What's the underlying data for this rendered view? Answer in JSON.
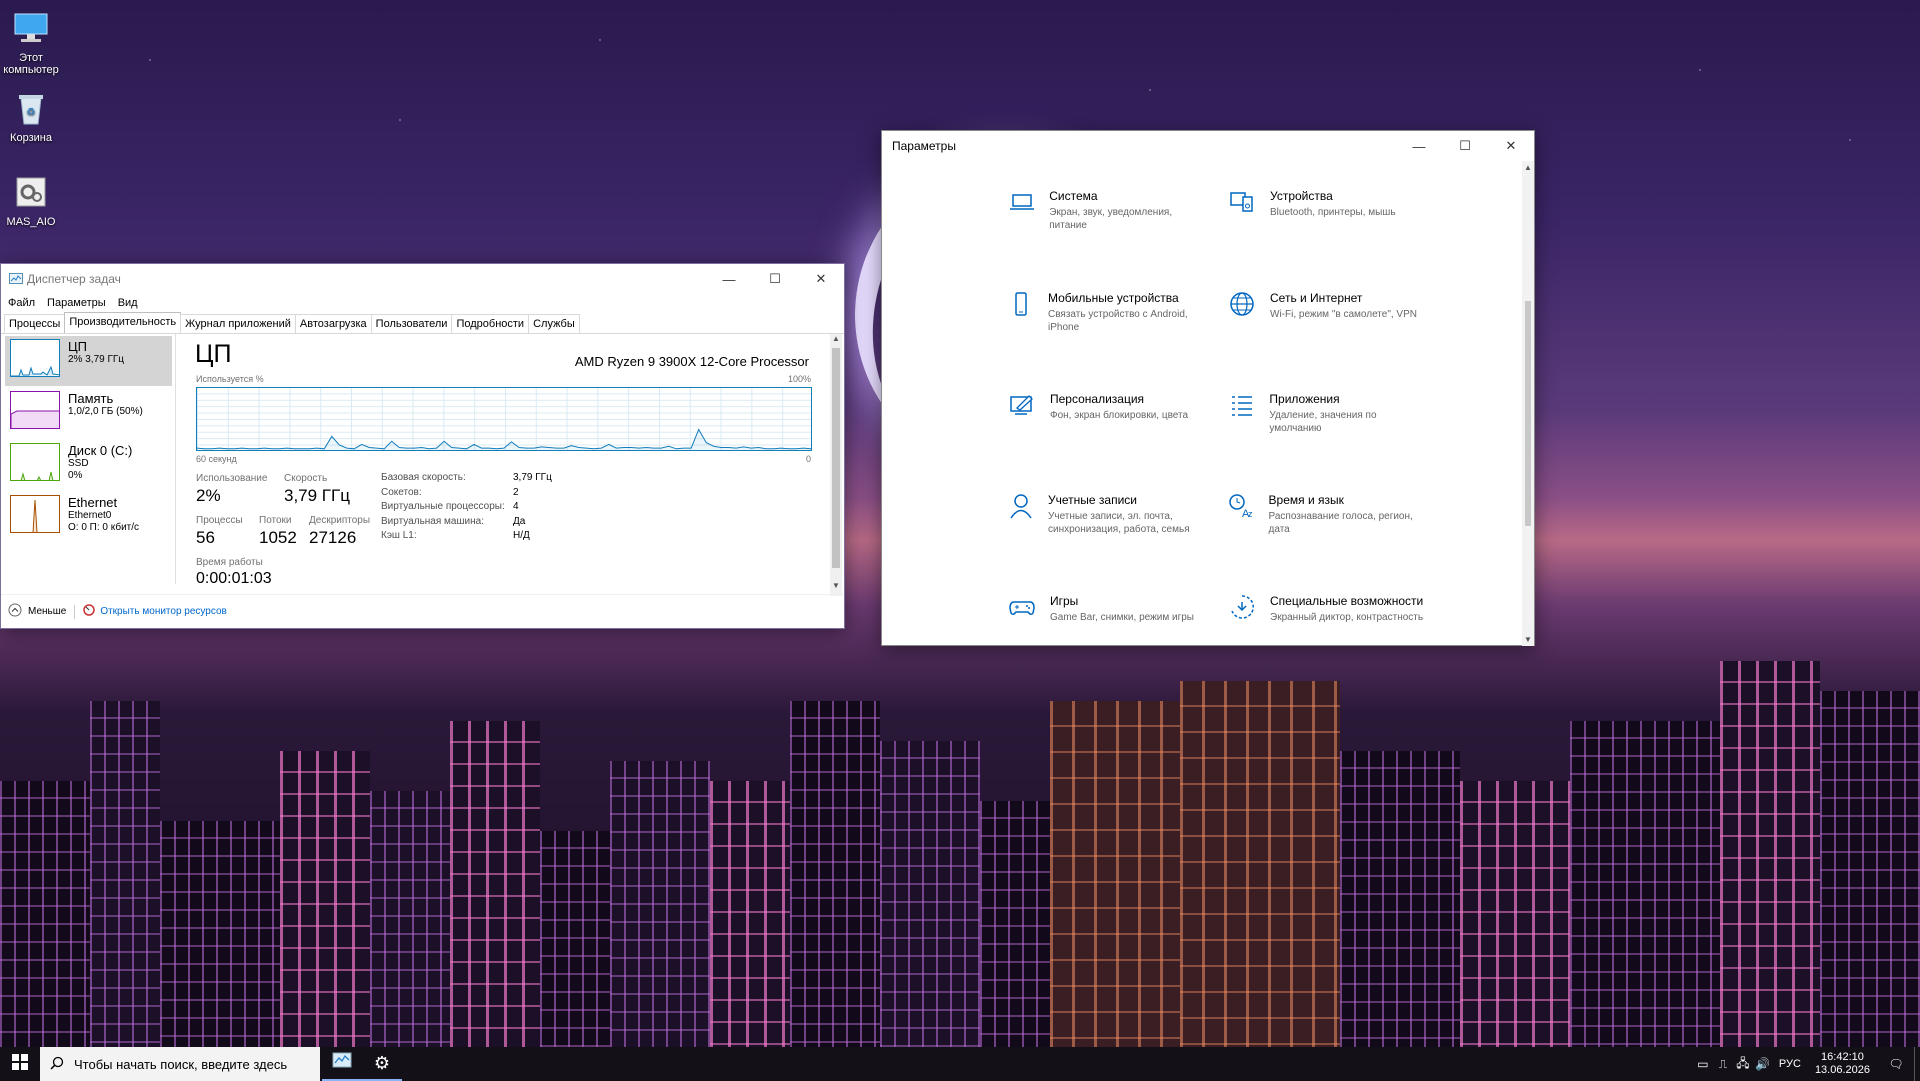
{
  "desktop": {
    "icons": [
      {
        "label": "Этот компьютер",
        "icon": "computer-icon"
      },
      {
        "label": "Корзина",
        "icon": "recycle-bin-icon"
      },
      {
        "label": "MAS_AIO",
        "icon": "batch-file-icon"
      }
    ]
  },
  "task_manager": {
    "title": "Диспетчер задач",
    "menu": [
      "Файл",
      "Параметры",
      "Вид"
    ],
    "tabs": [
      "Процессы",
      "Производительность",
      "Журнал приложений",
      "Автозагрузка",
      "Пользователи",
      "Подробности",
      "Службы"
    ],
    "active_tab": "Производительность",
    "resources": [
      {
        "name": "ЦП",
        "sub1": "2% 3,79 ГГц",
        "sub2": "",
        "sub3": "",
        "color": "#117dbb"
      },
      {
        "name": "Память",
        "sub1": "1,0/2,0 ГБ (50%)",
        "sub2": "",
        "sub3": "",
        "color": "#8b12ae"
      },
      {
        "name": "Диск 0 (C:)",
        "sub1": "SSD",
        "sub2": "0%",
        "sub3": "",
        "color": "#4da60c"
      },
      {
        "name": "Ethernet",
        "sub1": "Ethernet0",
        "sub2": "О: 0 П: 0 кбит/с",
        "sub3": "",
        "color": "#a74f01"
      }
    ],
    "cpu": {
      "heading": "ЦП",
      "model": "AMD Ryzen 9 3900X 12-Core Processor",
      "graph_label": "Используется %",
      "graph_max": "100%",
      "graph_time": "60 секунд",
      "graph_min": "0",
      "usage_label": "Использование",
      "usage_value": "2%",
      "speed_label": "Скорость",
      "speed_value": "3,79 ГГц",
      "processes_label": "Процессы",
      "processes_value": "56",
      "threads_label": "Потоки",
      "threads_value": "1052",
      "handles_label": "Дескрипторы",
      "handles_value": "27126",
      "uptime_label": "Время работы",
      "uptime_value": "0:00:01:03",
      "details": [
        {
          "k": "Базовая скорость:",
          "v": "3,79 ГГц"
        },
        {
          "k": "Сокетов:",
          "v": "2"
        },
        {
          "k": "Виртуальные процессоры:",
          "v": "4"
        },
        {
          "k": "Виртуальная машина:",
          "v": "Да"
        },
        {
          "k": "Кэш L1:",
          "v": "Н/Д"
        }
      ],
      "usage_history": [
        3,
        2,
        2,
        3,
        2,
        2,
        3,
        2,
        2,
        3,
        2,
        2,
        3,
        2,
        2,
        2,
        3,
        2,
        22,
        8,
        3,
        2,
        9,
        4,
        3,
        2,
        14,
        4,
        3,
        3,
        4,
        2,
        3,
        14,
        4,
        3,
        2,
        9,
        3,
        3,
        2,
        3,
        13,
        4,
        3,
        3,
        5,
        4,
        3,
        3,
        7,
        4,
        3,
        2,
        3,
        9,
        3,
        4,
        4,
        3,
        4,
        3,
        3,
        6,
        2,
        3,
        3,
        33,
        12,
        6,
        4,
        4,
        3,
        5,
        3,
        4,
        2,
        2,
        3,
        2,
        2,
        3,
        2
      ]
    },
    "footer": {
      "fewer": "Меньше",
      "resmon": "Открыть монитор ресурсов"
    }
  },
  "settings": {
    "title": "Параметры",
    "items": [
      {
        "title": "Система",
        "desc": "Экран, звук, уведомления, питание",
        "icon": "laptop-icon"
      },
      {
        "title": "Устройства",
        "desc": "Bluetooth, принтеры, мышь",
        "icon": "devices-icon"
      },
      {
        "title": "Мобильные устройства",
        "desc": "Связать устройство с Android, iPhone",
        "icon": "phone-icon"
      },
      {
        "title": "Сеть и Интернет",
        "desc": "Wi-Fi, режим \"в самолете\", VPN",
        "icon": "globe-icon"
      },
      {
        "title": "Персонализация",
        "desc": "Фон, экран блокировки, цвета",
        "icon": "personalization-icon"
      },
      {
        "title": "Приложения",
        "desc": "Удаление, значения по умолчанию",
        "icon": "apps-list-icon"
      },
      {
        "title": "Учетные записи",
        "desc": "Учетные записи, эл. почта, синхронизация, работа, семья",
        "icon": "person-icon"
      },
      {
        "title": "Время и язык",
        "desc": "Распознавание голоса, регион, дата",
        "icon": "time-language-icon"
      },
      {
        "title": "Игры",
        "desc": "Game Bar, снимки, режим игры",
        "icon": "gamepad-icon"
      },
      {
        "title": "Специальные возможности",
        "desc": "Экранный диктор, контрастность",
        "icon": "accessibility-icon"
      }
    ]
  },
  "taskbar": {
    "search_placeholder": "Чтобы начать поиск, введите здесь",
    "lang": "РУС",
    "time": "16:42:10",
    "date": "13.06.2026"
  }
}
